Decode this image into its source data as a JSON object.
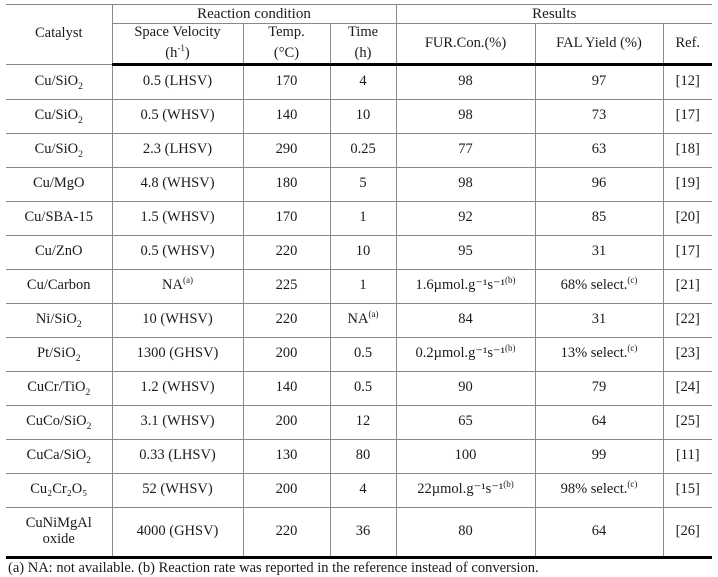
{
  "table": {
    "header": {
      "catalyst": "Catalyst",
      "group_reaction_condition": "Reaction condition",
      "group_results": "Results",
      "space_velocity_l1": "Space Velocity",
      "space_velocity_l2_base": "(h",
      "space_velocity_l2_sup": "-1",
      "space_velocity_l2_tail": ")",
      "temp_l1": "Temp.",
      "temp_l2": "(°C)",
      "time_l1": "Time",
      "time_l2": "(h)",
      "fur_con": "FUR.Con.(%)",
      "fal_yield": "FAL Yield (%)",
      "ref": "Ref."
    },
    "columns": [
      "Catalyst",
      "Space Velocity (h-1)",
      "Temp. (°C)",
      "Time (h)",
      "FUR.Con.(%)",
      "FAL Yield (%)",
      "Ref."
    ],
    "rows": [
      {
        "catalyst": "Cu/SiO",
        "catalyst_sub": "2",
        "catalyst_tail": "",
        "space_velocity": "0.5 (LHSV)",
        "space_velocity_sup": "",
        "temp": "170",
        "time": "4",
        "time_sup": "",
        "fur_con": "98",
        "fur_con_sup": "",
        "fal_yield": "97",
        "fal_yield_sup": "",
        "ref": "[12]"
      },
      {
        "catalyst": "Cu/SiO",
        "catalyst_sub": "2",
        "catalyst_tail": "",
        "space_velocity": "0.5 (WHSV)",
        "space_velocity_sup": "",
        "temp": "140",
        "time": "10",
        "time_sup": "",
        "fur_con": "98",
        "fur_con_sup": "",
        "fal_yield": "73",
        "fal_yield_sup": "",
        "ref": "[17]"
      },
      {
        "catalyst": "Cu/SiO",
        "catalyst_sub": "2",
        "catalyst_tail": "",
        "space_velocity": "2.3 (LHSV)",
        "space_velocity_sup": "",
        "temp": "290",
        "time": "0.25",
        "time_sup": "",
        "fur_con": "77",
        "fur_con_sup": "",
        "fal_yield": "63",
        "fal_yield_sup": "",
        "ref": "[18]"
      },
      {
        "catalyst": "Cu/MgO",
        "catalyst_sub": "",
        "catalyst_tail": "",
        "space_velocity": "4.8 (WHSV)",
        "space_velocity_sup": "",
        "temp": "180",
        "time": "5",
        "time_sup": "",
        "fur_con": "98",
        "fur_con_sup": "",
        "fal_yield": "96",
        "fal_yield_sup": "",
        "ref": "[19]"
      },
      {
        "catalyst": "Cu/SBA-15",
        "catalyst_sub": "",
        "catalyst_tail": "",
        "space_velocity": "1.5 (WHSV)",
        "space_velocity_sup": "",
        "temp": "170",
        "time": "1",
        "time_sup": "",
        "fur_con": "92",
        "fur_con_sup": "",
        "fal_yield": "85",
        "fal_yield_sup": "",
        "ref": "[20]"
      },
      {
        "catalyst": "Cu/ZnO",
        "catalyst_sub": "",
        "catalyst_tail": "",
        "space_velocity": "0.5 (WHSV)",
        "space_velocity_sup": "",
        "temp": "220",
        "time": "10",
        "time_sup": "",
        "fur_con": "95",
        "fur_con_sup": "",
        "fal_yield": "31",
        "fal_yield_sup": "",
        "ref": "[17]"
      },
      {
        "catalyst": "Cu/Carbon",
        "catalyst_sub": "",
        "catalyst_tail": "",
        "space_velocity": "NA",
        "space_velocity_sup": "(a)",
        "temp": "225",
        "time": "1",
        "time_sup": "",
        "fur_con": "1.6µmol.g⁻¹s⁻¹",
        "fur_con_sup": "(b)",
        "fal_yield": "68% select.",
        "fal_yield_sup": "(c)",
        "ref": "[21]"
      },
      {
        "catalyst": "Ni/SiO",
        "catalyst_sub": "2",
        "catalyst_tail": "",
        "space_velocity": "10 (WHSV)",
        "space_velocity_sup": "",
        "temp": "220",
        "time": "NA",
        "time_sup": "(a)",
        "fur_con": "84",
        "fur_con_sup": "",
        "fal_yield": "31",
        "fal_yield_sup": "",
        "ref": "[22]"
      },
      {
        "catalyst": "Pt/SiO",
        "catalyst_sub": "2",
        "catalyst_tail": "",
        "space_velocity": "1300 (GHSV)",
        "space_velocity_sup": "",
        "temp": "200",
        "time": "0.5",
        "time_sup": "",
        "fur_con": "0.2µmol.g⁻¹s⁻¹",
        "fur_con_sup": "(b)",
        "fal_yield": "13% select.",
        "fal_yield_sup": "(c)",
        "ref": "[23]"
      },
      {
        "catalyst": "CuCr/TiO",
        "catalyst_sub": "2",
        "catalyst_tail": "",
        "space_velocity": "1.2 (WHSV)",
        "space_velocity_sup": "",
        "temp": "140",
        "time": "0.5",
        "time_sup": "",
        "fur_con": "90",
        "fur_con_sup": "",
        "fal_yield": "79",
        "fal_yield_sup": "",
        "ref": "[24]"
      },
      {
        "catalyst": "CuCo/SiO",
        "catalyst_sub": "2",
        "catalyst_tail": "",
        "space_velocity": "3.1 (WHSV)",
        "space_velocity_sup": "",
        "temp": "200",
        "time": "12",
        "time_sup": "",
        "fur_con": "65",
        "fur_con_sup": "",
        "fal_yield": "64",
        "fal_yield_sup": "",
        "ref": "[25]"
      },
      {
        "catalyst": "CuCa/SiO",
        "catalyst_sub": "2",
        "catalyst_tail": "",
        "space_velocity": "0.33 (LHSV)",
        "space_velocity_sup": "",
        "temp": "130",
        "time": "80",
        "time_sup": "",
        "fur_con": "100",
        "fur_con_sup": "",
        "fal_yield": "99",
        "fal_yield_sup": "",
        "ref": "[11]"
      },
      {
        "catalyst": "Cu₂Cr₂O₅",
        "catalyst_sub": "",
        "catalyst_tail": "",
        "space_velocity": "52 (WHSV)",
        "space_velocity_sup": "",
        "temp": "200",
        "time": "4",
        "time_sup": "",
        "fur_con": "22µmol.g⁻¹s⁻¹",
        "fur_con_sup": "(b)",
        "fal_yield": "98% select.",
        "fal_yield_sup": "(c)",
        "ref": "[15]"
      },
      {
        "catalyst": "CuNiMgAl",
        "catalyst_sub": "",
        "catalyst_tail": "oxide",
        "space_velocity": "4000 (GHSV)",
        "space_velocity_sup": "",
        "temp": "220",
        "time": "36",
        "time_sup": "",
        "fur_con": "80",
        "fur_con_sup": "",
        "fal_yield": "64",
        "fal_yield_sup": "",
        "ref": "[26]"
      }
    ]
  },
  "footnote": {
    "text": "(a) NA: not available.  (b) Reaction rate was reported in the reference instead of conversion."
  }
}
